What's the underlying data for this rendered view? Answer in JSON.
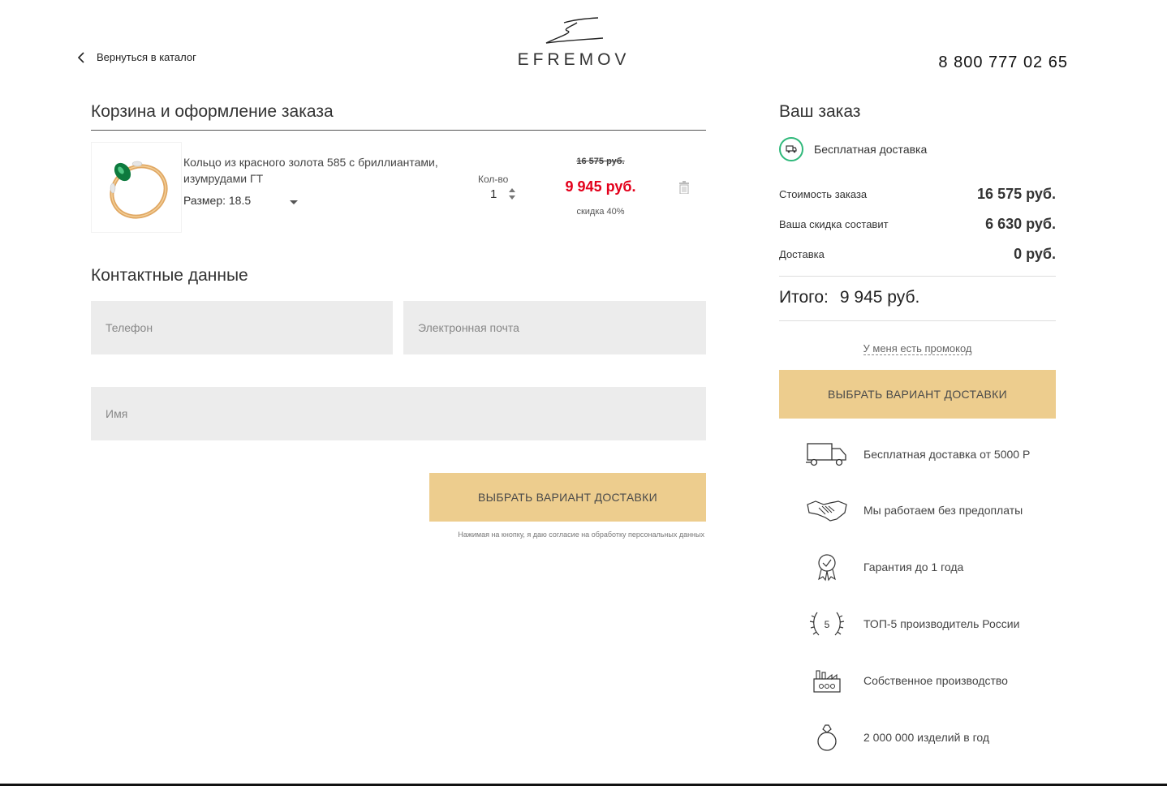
{
  "header": {
    "back_label": "Вернуться в каталог",
    "logo_text": "EFREMOV",
    "phone": "8 800 777 02 65"
  },
  "cart": {
    "title": "Корзина и оформление заказа",
    "item": {
      "name": "Кольцо из красного золота 585 с бриллиантами, изумрудами ГТ",
      "size_label": "Размер: 18.5",
      "qty_label": "Кол-во",
      "qty_value": "1",
      "price_old": "16 575 руб.",
      "price_new": "9 945 руб.",
      "discount": "скидка 40%"
    }
  },
  "contacts": {
    "title": "Контактные данные",
    "phone_placeholder": "Телефон",
    "email_placeholder": "Электронная почта",
    "name_placeholder": "Имя",
    "submit_label": "ВЫБРАТЬ ВАРИАНТ ДОСТАВКИ",
    "consent": "Нажимая на кнопку, я даю согласие на обработку персональных данных"
  },
  "order": {
    "title": "Ваш заказ",
    "free_delivery": "Бесплатная доставка",
    "rows": [
      {
        "label": "Стоимость заказа",
        "value": "16 575 руб."
      },
      {
        "label": "Ваша скидка составит",
        "value": "6 630 руб."
      },
      {
        "label": "Доставка",
        "value": "0 руб."
      }
    ],
    "total_label": "Итого:",
    "total_value": "9 945 руб.",
    "promo": "У меня есть промокод",
    "button": "ВЫБРАТЬ ВАРИАНТ ДОСТАВКИ"
  },
  "features": [
    {
      "icon": "truck-icon",
      "text": "Бесплатная доставка от 5000 Р"
    },
    {
      "icon": "handshake-icon",
      "text": "Мы работаем без предоплаты"
    },
    {
      "icon": "award-icon",
      "text": "Гарантия до 1 года"
    },
    {
      "icon": "laurel-icon",
      "text": "ТОП-5 производитель России",
      "badge": "5"
    },
    {
      "icon": "factory-icon",
      "text": "Собственное производство"
    },
    {
      "icon": "ring-icon",
      "text": "2 000 000 изделий в год"
    }
  ],
  "colors": {
    "accent_gold": "#edcd8e",
    "price_red": "#e3001b",
    "badge_green": "#2fb87a"
  }
}
